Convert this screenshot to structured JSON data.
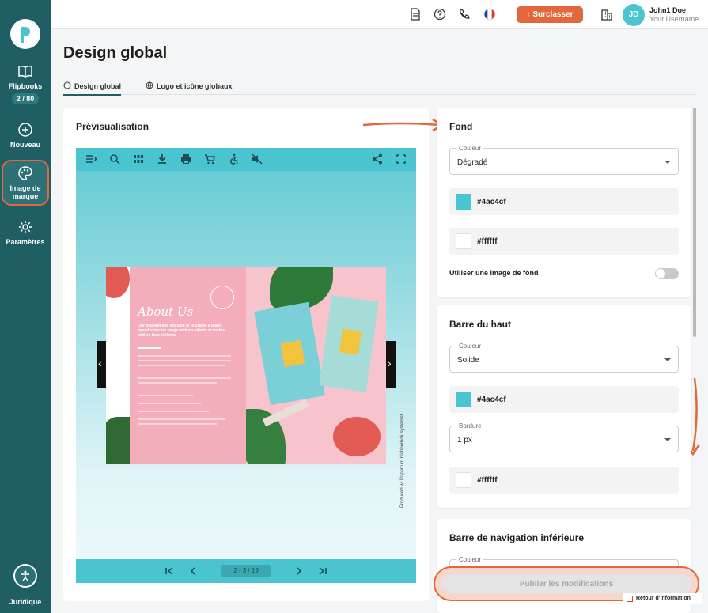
{
  "sidebar": {
    "items": [
      {
        "label": "Flipbooks",
        "badge": "2 / 80"
      },
      {
        "label": "Nouveau"
      },
      {
        "label": "Image de marque"
      },
      {
        "label": "Paramètres"
      }
    ],
    "footer": "Juridique"
  },
  "topbar": {
    "upgrade_label": "Surclasser",
    "user": {
      "initials": "JD",
      "name": "John1 Doe",
      "username": "Your Username"
    }
  },
  "page": {
    "title": "Design global",
    "tabs": [
      {
        "label": "Design global",
        "active": true
      },
      {
        "label": "Logo et icône globaux",
        "active": false
      }
    ]
  },
  "preview": {
    "title": "Prévisualisation",
    "page_indicator": "2 - 3 / 19",
    "book_heading": "About Us",
    "book_subheading": "Our passion and mission is to create a plant-based skincare range with no talents or toxins and no face-violence",
    "credit": "Produced w/ Paperturn blabberbok systemet"
  },
  "sections": {
    "fond": {
      "title": "Fond",
      "couleur_label": "Couleur",
      "couleur_value": "Dégradé",
      "color1": "#4ac4cf",
      "color2": "#ffffff",
      "bg_image_label": "Utiliser une image de fond"
    },
    "barre_haut": {
      "title": "Barre du haut",
      "couleur_label": "Couleur",
      "couleur_value": "Solide",
      "color1": "#4ac4cf",
      "bordure_label": "Bordure",
      "bordure_value": "1 px",
      "color2": "#ffffff"
    },
    "barre_nav": {
      "title": "Barre de navigation inférieure",
      "couleur_label": "Couleur"
    }
  },
  "publish_label": "Publier les modifications",
  "feedback_label": "Retour d'information",
  "colors": {
    "accent": "#e2673a",
    "sidebar": "#1f5f63",
    "brand_teal": "#4ac4cf"
  }
}
